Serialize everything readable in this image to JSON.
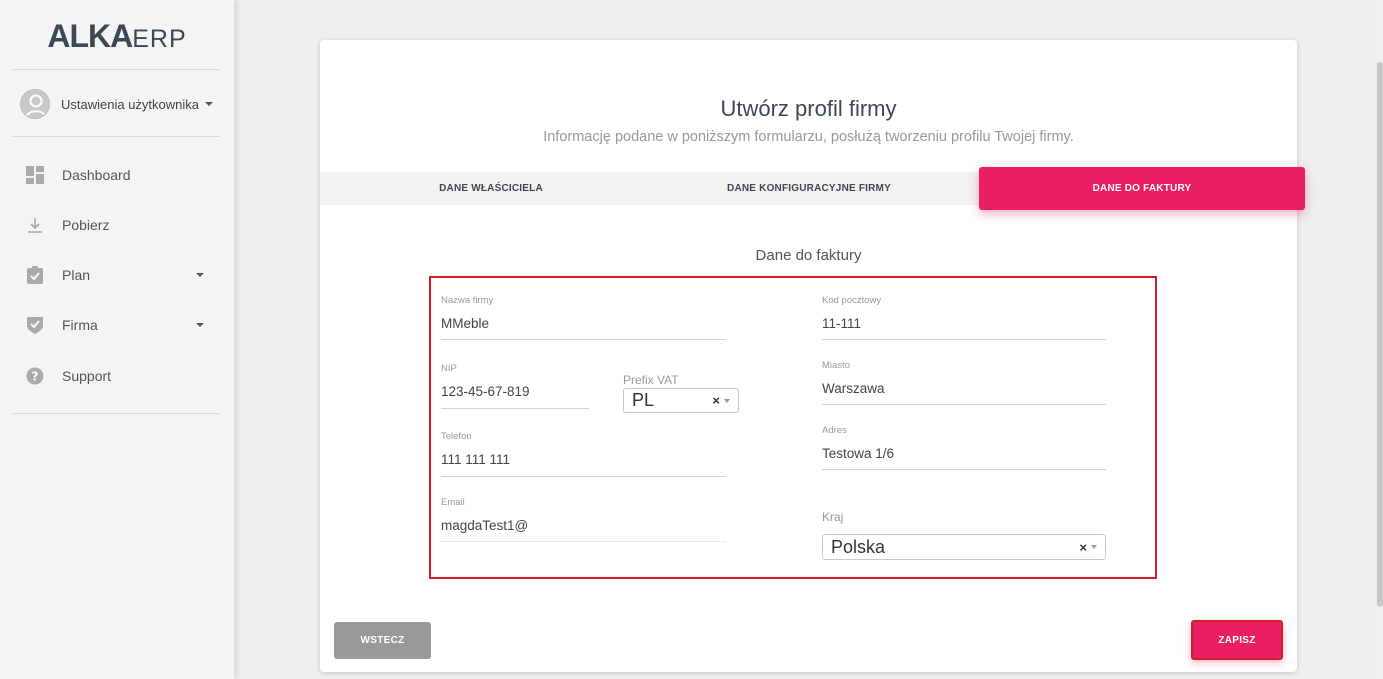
{
  "logo": {
    "main": "ALKA",
    "suffix": "ERP"
  },
  "user": {
    "label": "Ustawienia użytkownika"
  },
  "sidebar": {
    "items": [
      {
        "label": "Dashboard",
        "icon": "dashboard-icon"
      },
      {
        "label": "Pobierz",
        "icon": "download-icon"
      },
      {
        "label": "Plan",
        "icon": "clipboard-check-icon"
      },
      {
        "label": "Firma",
        "icon": "shield-check-icon"
      },
      {
        "label": "Support",
        "icon": "help-icon"
      }
    ]
  },
  "page": {
    "title": "Utwórz profil firmy",
    "subtitle": "Informację podane w poniższym formularzu, posłużą tworzeniu profilu Twojej firmy."
  },
  "tabs": [
    {
      "label": "DANE WŁAŚCICIELA",
      "active": false
    },
    {
      "label": "DANE KONFIGURACYJNE FIRMY",
      "active": false
    },
    {
      "label": "DANE DO FAKTURY",
      "active": true
    }
  ],
  "section": {
    "title": "Dane do faktury"
  },
  "form": {
    "company_name": {
      "label": "Nazwa firmy",
      "value": "MMeble"
    },
    "nip": {
      "label": "NIP",
      "value": "123-45-67-819"
    },
    "vat_prefix": {
      "label": "Prefix VAT",
      "value": "PL",
      "clear": "×"
    },
    "phone": {
      "label": "Telefon",
      "value": "111 111 111"
    },
    "email": {
      "label": "Email",
      "value": "magdaTest1@"
    },
    "postal_code": {
      "label": "Kod pocztowy",
      "value": "11-111"
    },
    "city": {
      "label": "Miasto",
      "value": "Warszawa"
    },
    "address": {
      "label": "Adres",
      "value": "Testowa 1/6"
    },
    "country": {
      "label": "Kraj",
      "value": "Polska",
      "clear": "×"
    }
  },
  "buttons": {
    "back": "WSTECZ",
    "save": "ZAPISZ"
  },
  "colors": {
    "accent": "#e91e63",
    "highlight_border": "#d0202a",
    "back_button": "#999999"
  }
}
